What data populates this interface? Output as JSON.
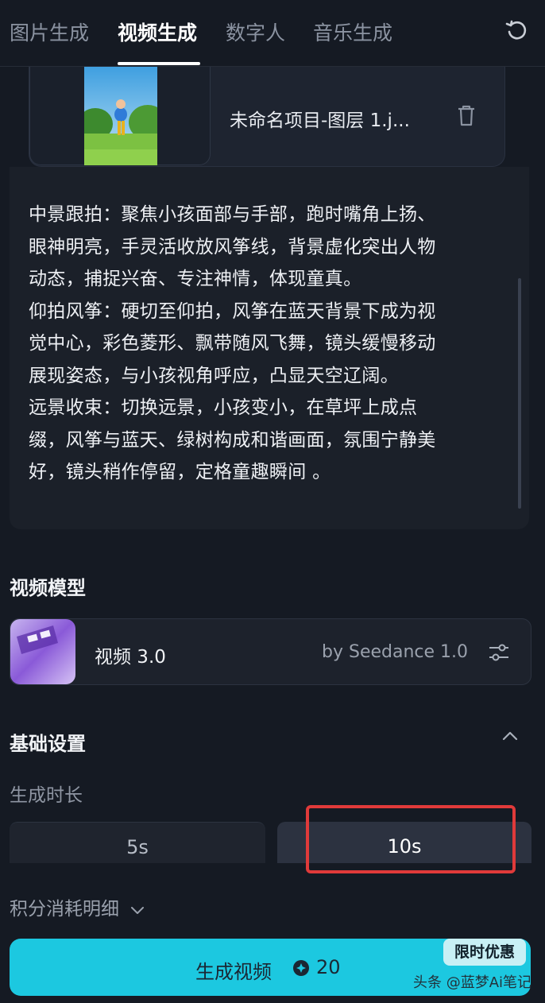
{
  "tabs": [
    {
      "label": "图片生成",
      "active": false
    },
    {
      "label": "视频生成",
      "active": true
    },
    {
      "label": "数字人",
      "active": false
    },
    {
      "label": "音乐生成",
      "active": false
    }
  ],
  "upload": {
    "file_name": "未命名项目-图层 1.j..."
  },
  "prompt": {
    "text": "中景跟拍：聚焦小孩面部与手部，跑时嘴角上扬、\n眼神明亮，手灵活收放风筝线，背景虚化突出人物\n动态，捕捉兴奋、专注神情，体现童真。\n仰拍风筝：硬切至仰拍，风筝在蓝天背景下成为视\n觉中心，彩色菱形、飘带随风飞舞，镜头缓慢移动\n展现姿态，与小孩视角呼应，凸显天空辽阔。\n远景收束：切换远景，小孩变小，在草坪上成点\n缀，风筝与蓝天、绿树构成和谐画面，氛围宁静美\n好，镜头稍作停留，定格童趣瞬间 。"
  },
  "model_section": {
    "label": "视频模型",
    "model_name": "视频 3.0",
    "model_by": "by Seedance 1.0"
  },
  "basic_settings": {
    "label": "基础设置",
    "duration_label": "生成时长",
    "durations": [
      "5s",
      "10s"
    ],
    "selected_duration": "10s"
  },
  "points_detail": "积分消耗明细",
  "generate": {
    "label": "生成视频",
    "cost": "20",
    "promo": "限时优惠"
  },
  "watermark": "头条 @蓝梦Ai笔记",
  "colors": {
    "background": "#151a23",
    "accent": "#1cc8e0",
    "highlight": "#e03a3a"
  }
}
